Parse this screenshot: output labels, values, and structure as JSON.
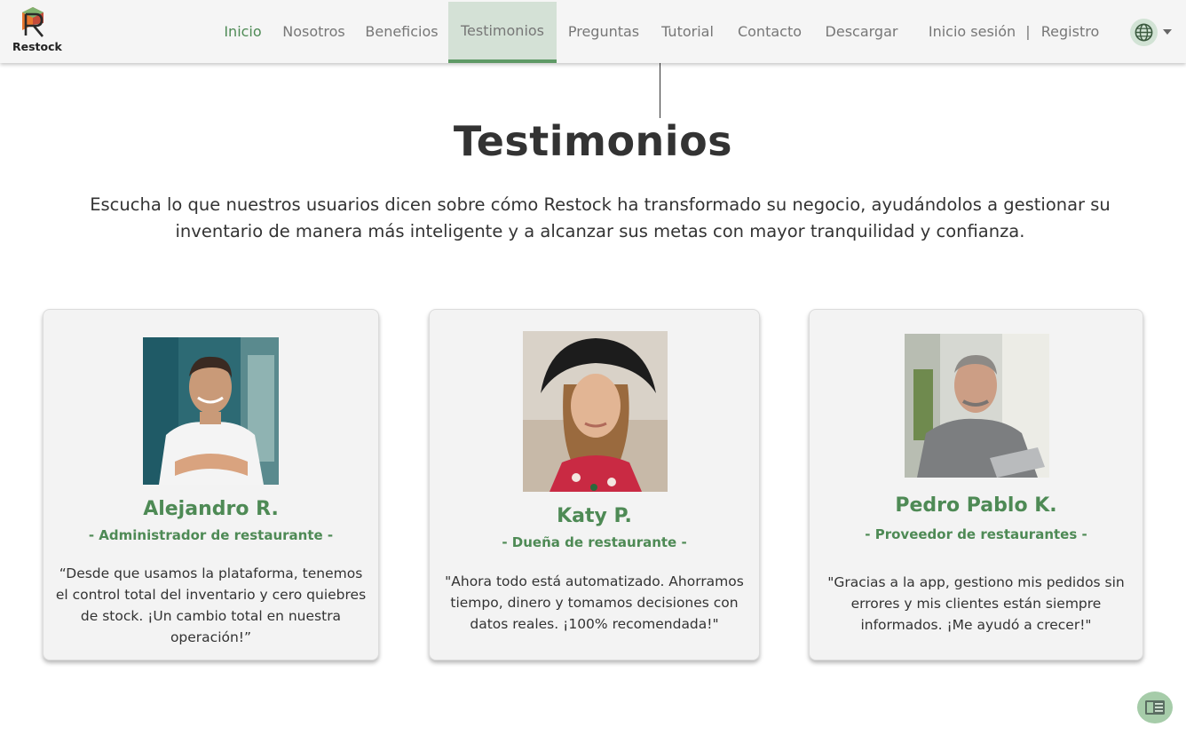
{
  "brand": {
    "name": "Restock"
  },
  "nav": {
    "items": [
      {
        "label": "Inicio"
      },
      {
        "label": "Nosotros"
      },
      {
        "label": "Beneficios"
      },
      {
        "label": "Testimonios"
      },
      {
        "label": "Preguntas"
      },
      {
        "label": "Tutorial"
      },
      {
        "label": "Contacto"
      },
      {
        "label": "Descargar"
      }
    ],
    "login": "Inicio sesión",
    "separator": "|",
    "register": "Registro",
    "language_icon": "globe-icon",
    "active_color": "#4e8a55",
    "highlight_color": "#d4e1d6"
  },
  "section": {
    "title": "Testimonios",
    "subtitle": "Escucha lo que nuestros usuarios dicen sobre cómo Restock ha transformado su negocio, ayudándolos a gestionar su inventario de manera más inteligente y a alcanzar sus metas con mayor tranquilidad y confianza."
  },
  "testimonials": [
    {
      "name": "Alejandro R.",
      "role": "- Administrador de restaurante -",
      "quote": "“Desde que usamos la plataforma, tenemos el control total del inventario y cero quiebres de stock. ¡Un cambio total en nuestra operación!”"
    },
    {
      "name": "Katy P.",
      "role": "- Dueña de restaurante -",
      "quote": "\"Ahora todo está automatizado. Ahorramos tiempo, dinero y tomamos decisiones con datos reales. ¡100% recomendada!\""
    },
    {
      "name": "Pedro Pablo K.",
      "role": "- Proveedor de restaurantes -",
      "quote": "\"Gracias a la app, gestiono mis pedidos sin errores y mis clientes están siempre informados. ¡Me ayudó a crecer!\""
    }
  ],
  "accessibility": {
    "reader_icon": "reader-mode-icon"
  }
}
